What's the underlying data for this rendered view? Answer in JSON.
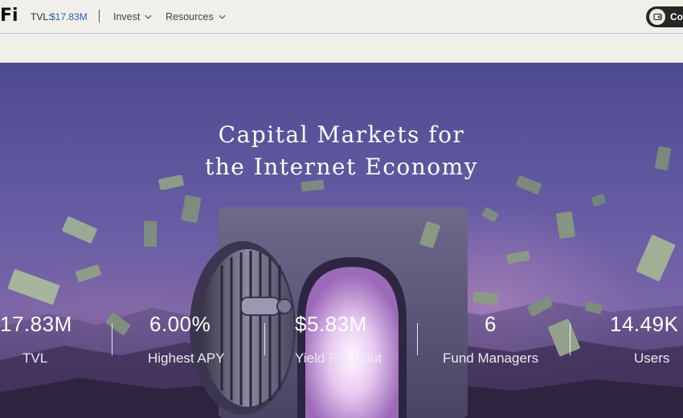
{
  "nav": {
    "logo": "Fi",
    "tvl_label": "TVL:",
    "tvl_value": "$17.83M",
    "menu": [
      {
        "label": "Invest"
      },
      {
        "label": "Resources"
      }
    ],
    "connect_label": "Co"
  },
  "hero": {
    "title_line1": "Capital Markets for",
    "title_line2": "the Internet Economy"
  },
  "stats": [
    {
      "value": "17.83M",
      "label": "TVL"
    },
    {
      "value": "6.00%",
      "label": "Highest APY"
    },
    {
      "value": "$5.83M",
      "label": "Yield Paid Out"
    },
    {
      "value": "6",
      "label": "Fund Managers"
    },
    {
      "value": "14.49K",
      "label": "Users"
    }
  ],
  "colors": {
    "accent_link": "#2c5cc0",
    "nav_bg": "#f1efe9",
    "connect_bg": "#262626"
  }
}
